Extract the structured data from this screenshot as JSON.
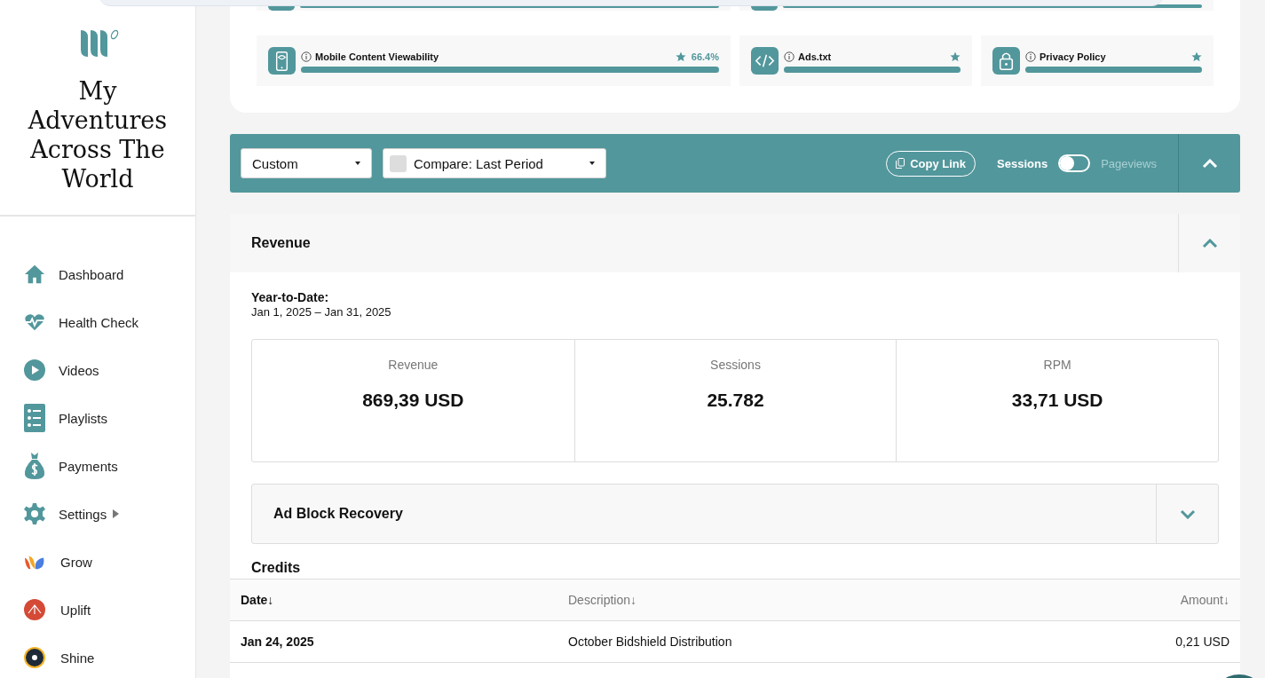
{
  "site": {
    "title": "My Adventures Across The World"
  },
  "sidebar": {
    "items": [
      {
        "label": "Dashboard",
        "kind": "home"
      },
      {
        "label": "Health Check",
        "kind": "heart"
      },
      {
        "label": "Videos",
        "kind": "play"
      },
      {
        "label": "Playlists",
        "kind": "list"
      },
      {
        "label": "Payments",
        "kind": "money"
      },
      {
        "label": "Settings",
        "kind": "settings"
      },
      {
        "label": "Grow",
        "kind": "grow"
      },
      {
        "label": "Uplift",
        "kind": "uplift"
      },
      {
        "label": "Shine",
        "kind": "shine"
      }
    ]
  },
  "health_checks": [
    {
      "label": "Mobile Content Viewability",
      "kind": "phone",
      "score": "66.4%",
      "level": 1
    },
    {
      "label": "Ads.txt",
      "kind": "code",
      "level": 1
    },
    {
      "label": "Privacy Policy",
      "kind": "lock",
      "level": 1
    }
  ],
  "filter_bar": {
    "range": "Custom",
    "compare": "Compare: Last Period",
    "copy_link": "Copy Link",
    "toggle_left": "Sessions",
    "toggle_right": "Pageviews",
    "toggle_on": false
  },
  "revenue": {
    "title": "Revenue",
    "expanded": true,
    "period_label": "Year-to-Date:",
    "period": "Jan 1, 2025 – Jan 31, 2025",
    "stats": [
      {
        "label": "Revenue",
        "value": "869,39 USD"
      },
      {
        "label": "Sessions",
        "value": "25.782"
      },
      {
        "label": "RPM",
        "value": "33,71 USD"
      }
    ],
    "ad_block": {
      "title": "Ad Block Recovery",
      "expanded": false
    },
    "credits": {
      "title": "Credits",
      "columns": [
        "Date↓",
        "Description↓",
        "Amount↓"
      ],
      "rows": [
        [
          "Jan 24, 2025",
          "October Bidshield Distribution",
          "0,21 USD"
        ]
      ]
    }
  }
}
